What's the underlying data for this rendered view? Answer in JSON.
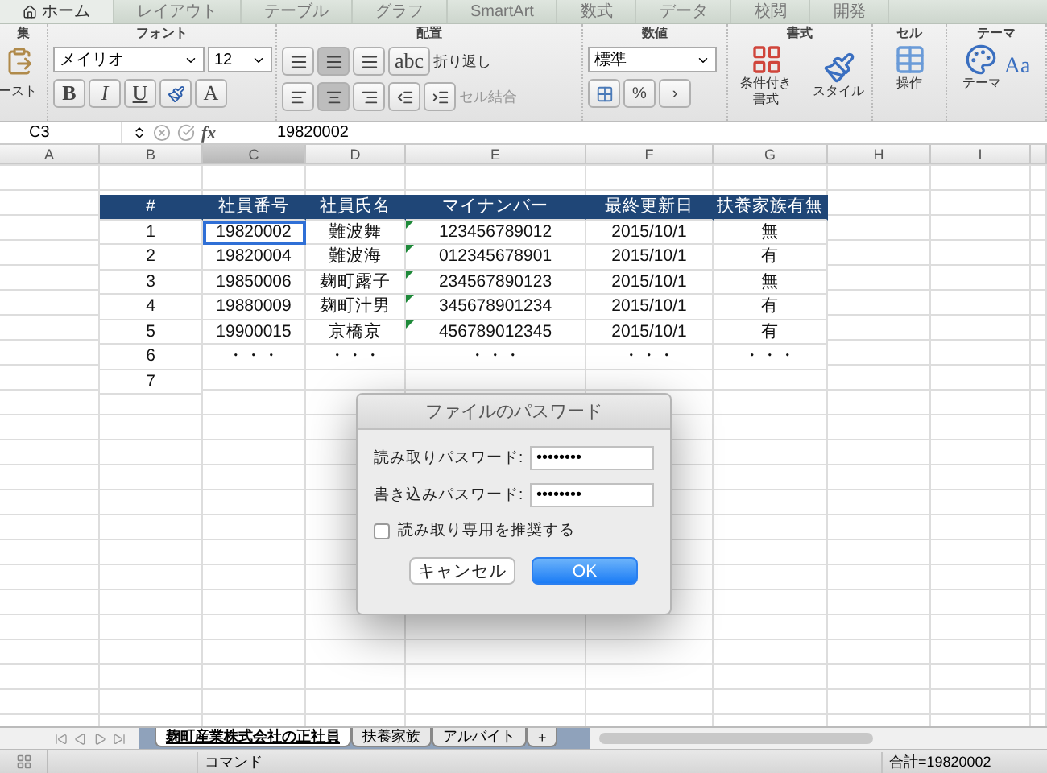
{
  "menu_tabs": [
    {
      "label": "ホーム",
      "selected": true
    },
    {
      "label": "レイアウト",
      "selected": false
    },
    {
      "label": "テーブル",
      "selected": false
    },
    {
      "label": "グラフ",
      "selected": false
    },
    {
      "label": "SmartArt",
      "selected": false
    },
    {
      "label": "数式",
      "selected": false
    },
    {
      "label": "データ",
      "selected": false
    },
    {
      "label": "校閲",
      "selected": false
    },
    {
      "label": "開発",
      "selected": false
    }
  ],
  "ribbon": {
    "edit": {
      "title": "集",
      "paste": "ースト"
    },
    "font": {
      "title": "フォント",
      "name": "メイリオ",
      "size": "12",
      "bold": "B",
      "italic": "I",
      "underline": "U",
      "text_color_label": "A"
    },
    "align": {
      "title": "配置",
      "orient": "abc",
      "wrap": "折り返し",
      "merge": "セル結合",
      "vertical": [
        {
          "selected": false
        },
        {
          "selected": true
        },
        {
          "selected": false
        }
      ],
      "horizontal": [
        {
          "selected": false
        },
        {
          "selected": true
        },
        {
          "selected": false
        }
      ]
    },
    "number": {
      "title": "数値",
      "format": "標準",
      "percent": "%",
      "comma": "›"
    },
    "format": {
      "title": "書式",
      "conditional": "条件付き書式",
      "style": "スタイル"
    },
    "cells": {
      "title": "セル",
      "action": "操作"
    },
    "theme": {
      "title": "テーマ",
      "theme": "テーマ",
      "aa": "Aa"
    }
  },
  "formula_bar": {
    "cell": "C3",
    "fx": "fx",
    "value": "19820002"
  },
  "columns": [
    {
      "label": "A",
      "selected": false
    },
    {
      "label": "B",
      "selected": false
    },
    {
      "label": "C",
      "selected": true
    },
    {
      "label": "D",
      "selected": false
    },
    {
      "label": "E",
      "selected": false
    },
    {
      "label": "F",
      "selected": false
    },
    {
      "label": "G",
      "selected": false
    },
    {
      "label": "H",
      "selected": false
    },
    {
      "label": "I",
      "selected": false
    }
  ],
  "table": {
    "header": [
      "#",
      "社員番号",
      "社員氏名",
      "マイナンバー",
      "最終更新日",
      "扶養家族有無"
    ],
    "rows": [
      {
        "cells": [
          "1",
          "19820002",
          "難波舞",
          "123456789012",
          "2015/10/1",
          "無"
        ],
        "id_selected": true,
        "flag": true
      },
      {
        "cells": [
          "2",
          "19820004",
          "難波海",
          "012345678901",
          "2015/10/1",
          "有"
        ],
        "id_selected": false,
        "flag": true
      },
      {
        "cells": [
          "3",
          "19850006",
          "麹町露子",
          "234567890123",
          "2015/10/1",
          "無"
        ],
        "id_selected": false,
        "flag": true
      },
      {
        "cells": [
          "4",
          "19880009",
          "麹町汁男",
          "345678901234",
          "2015/10/1",
          "有"
        ],
        "id_selected": false,
        "flag": true
      },
      {
        "cells": [
          "5",
          "19900015",
          "京橋京",
          "456789012345",
          "2015/10/1",
          "有"
        ],
        "id_selected": false,
        "flag": true
      },
      {
        "cells": [
          "6",
          "・・・",
          "・・・",
          "・・・",
          "・・・",
          "・・・"
        ],
        "id_selected": false,
        "flag": false
      },
      {
        "cells": [
          "7",
          "",
          "",
          "",
          "",
          ""
        ],
        "flag": false
      }
    ]
  },
  "dialog": {
    "title": "ファイルのパスワード",
    "fields": [
      {
        "label": "読み取りパスワード:",
        "value": "••••••••"
      },
      {
        "label": "書き込みパスワード:",
        "value": "••••••••"
      }
    ],
    "checkbox": {
      "label": "読み取り専用を推奨する",
      "checked": false
    },
    "buttons": [
      {
        "label": "キャンセル",
        "kind": "secondary"
      },
      {
        "label": "OK",
        "kind": "primary"
      }
    ]
  },
  "sheet_tabs": [
    {
      "label": "麹町産業株式会社の正社員",
      "selected": true
    },
    {
      "label": "扶養家族",
      "selected": false
    },
    {
      "label": "アルバイト",
      "selected": false
    }
  ],
  "add_sheet": "+",
  "status_bar": {
    "mode": "コマンド",
    "sum": "合計=19820002"
  }
}
